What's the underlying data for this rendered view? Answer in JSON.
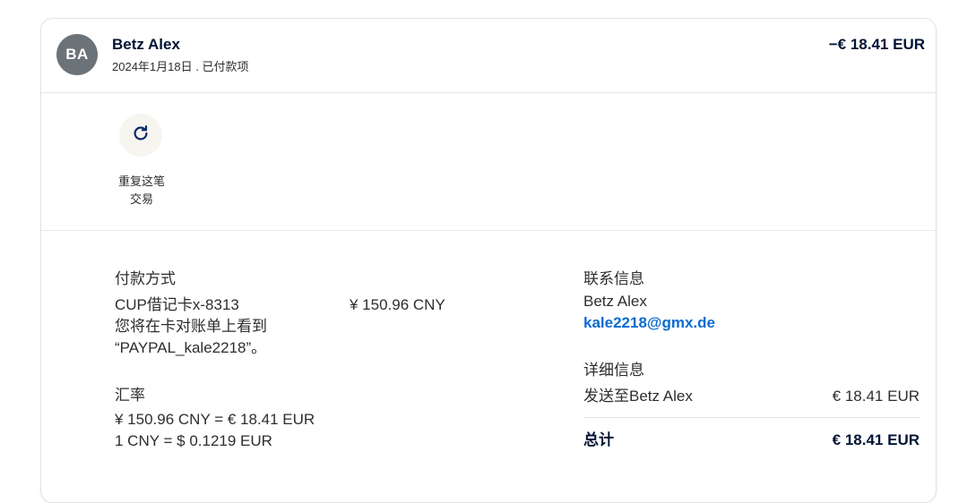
{
  "header": {
    "avatar_initials": "BA",
    "name": "Betz Alex",
    "subline": "2024年1月18日 . 已付款项",
    "amount": "−€ 18.41 EUR"
  },
  "actions": {
    "repeat_icon": "refresh-icon",
    "repeat_label_line1": "重复这笔",
    "repeat_label_line2": "交易"
  },
  "payment": {
    "title": "付款方式",
    "method": "CUP借记卡x-8313",
    "amount": "¥ 150.96 CNY",
    "statement_line1": "您将在卡对账单上看到",
    "statement_line2": "“PAYPAL_kale2218”。"
  },
  "exchange": {
    "title": "汇率",
    "line1": "¥ 150.96 CNY = € 18.41 EUR",
    "line2": "1 CNY = $ 0.1219 EUR"
  },
  "contact": {
    "title": "联系信息",
    "name": "Betz Alex",
    "email": "kale2218@gmx.de"
  },
  "details": {
    "title": "详细信息",
    "sent_to_label": "发送至Betz Alex",
    "sent_to_amount": "€ 18.41 EUR",
    "total_label": "总计",
    "total_amount": "€ 18.41 EUR"
  },
  "colors": {
    "avatar_bg": "#6c7378",
    "link": "#0a6bd1",
    "primary_text": "#001435"
  }
}
